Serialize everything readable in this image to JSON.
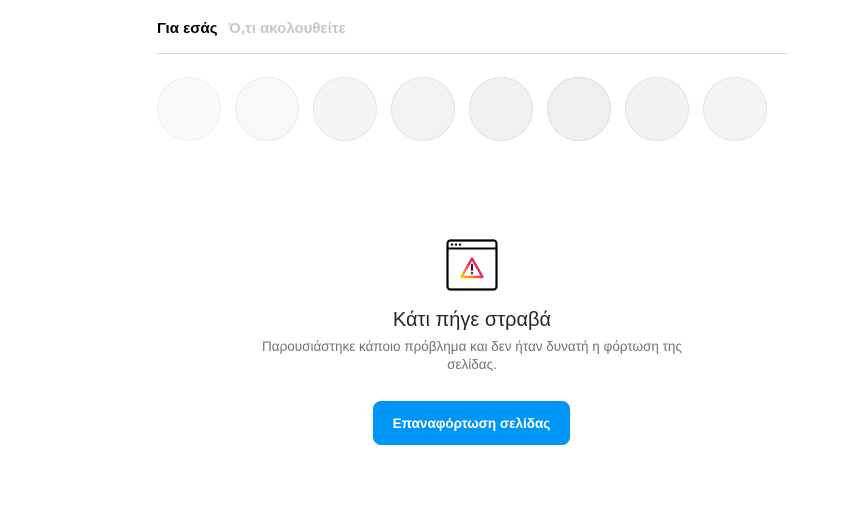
{
  "tabs": [
    {
      "label": "Για εσάς",
      "active": true
    },
    {
      "label": "Ό,τι ακολουθείτε",
      "active": false
    }
  ],
  "stories": {
    "count": 8
  },
  "error": {
    "icon": "browser-window-warning-icon",
    "title": "Κάτι πήγε στραβά",
    "description": "Παρουσιάστηκε κάποιο πρόβλημα και δεν ήταν δυνατή η φόρτωση της σελίδας.",
    "button_label": "Επαναφόρτωση σελίδας"
  },
  "colors": {
    "accent": "#0095f6",
    "text": "#262626",
    "secondary_text": "#737373",
    "inactive_tab": "#c7c7c7",
    "divider": "#dbdbdb"
  }
}
